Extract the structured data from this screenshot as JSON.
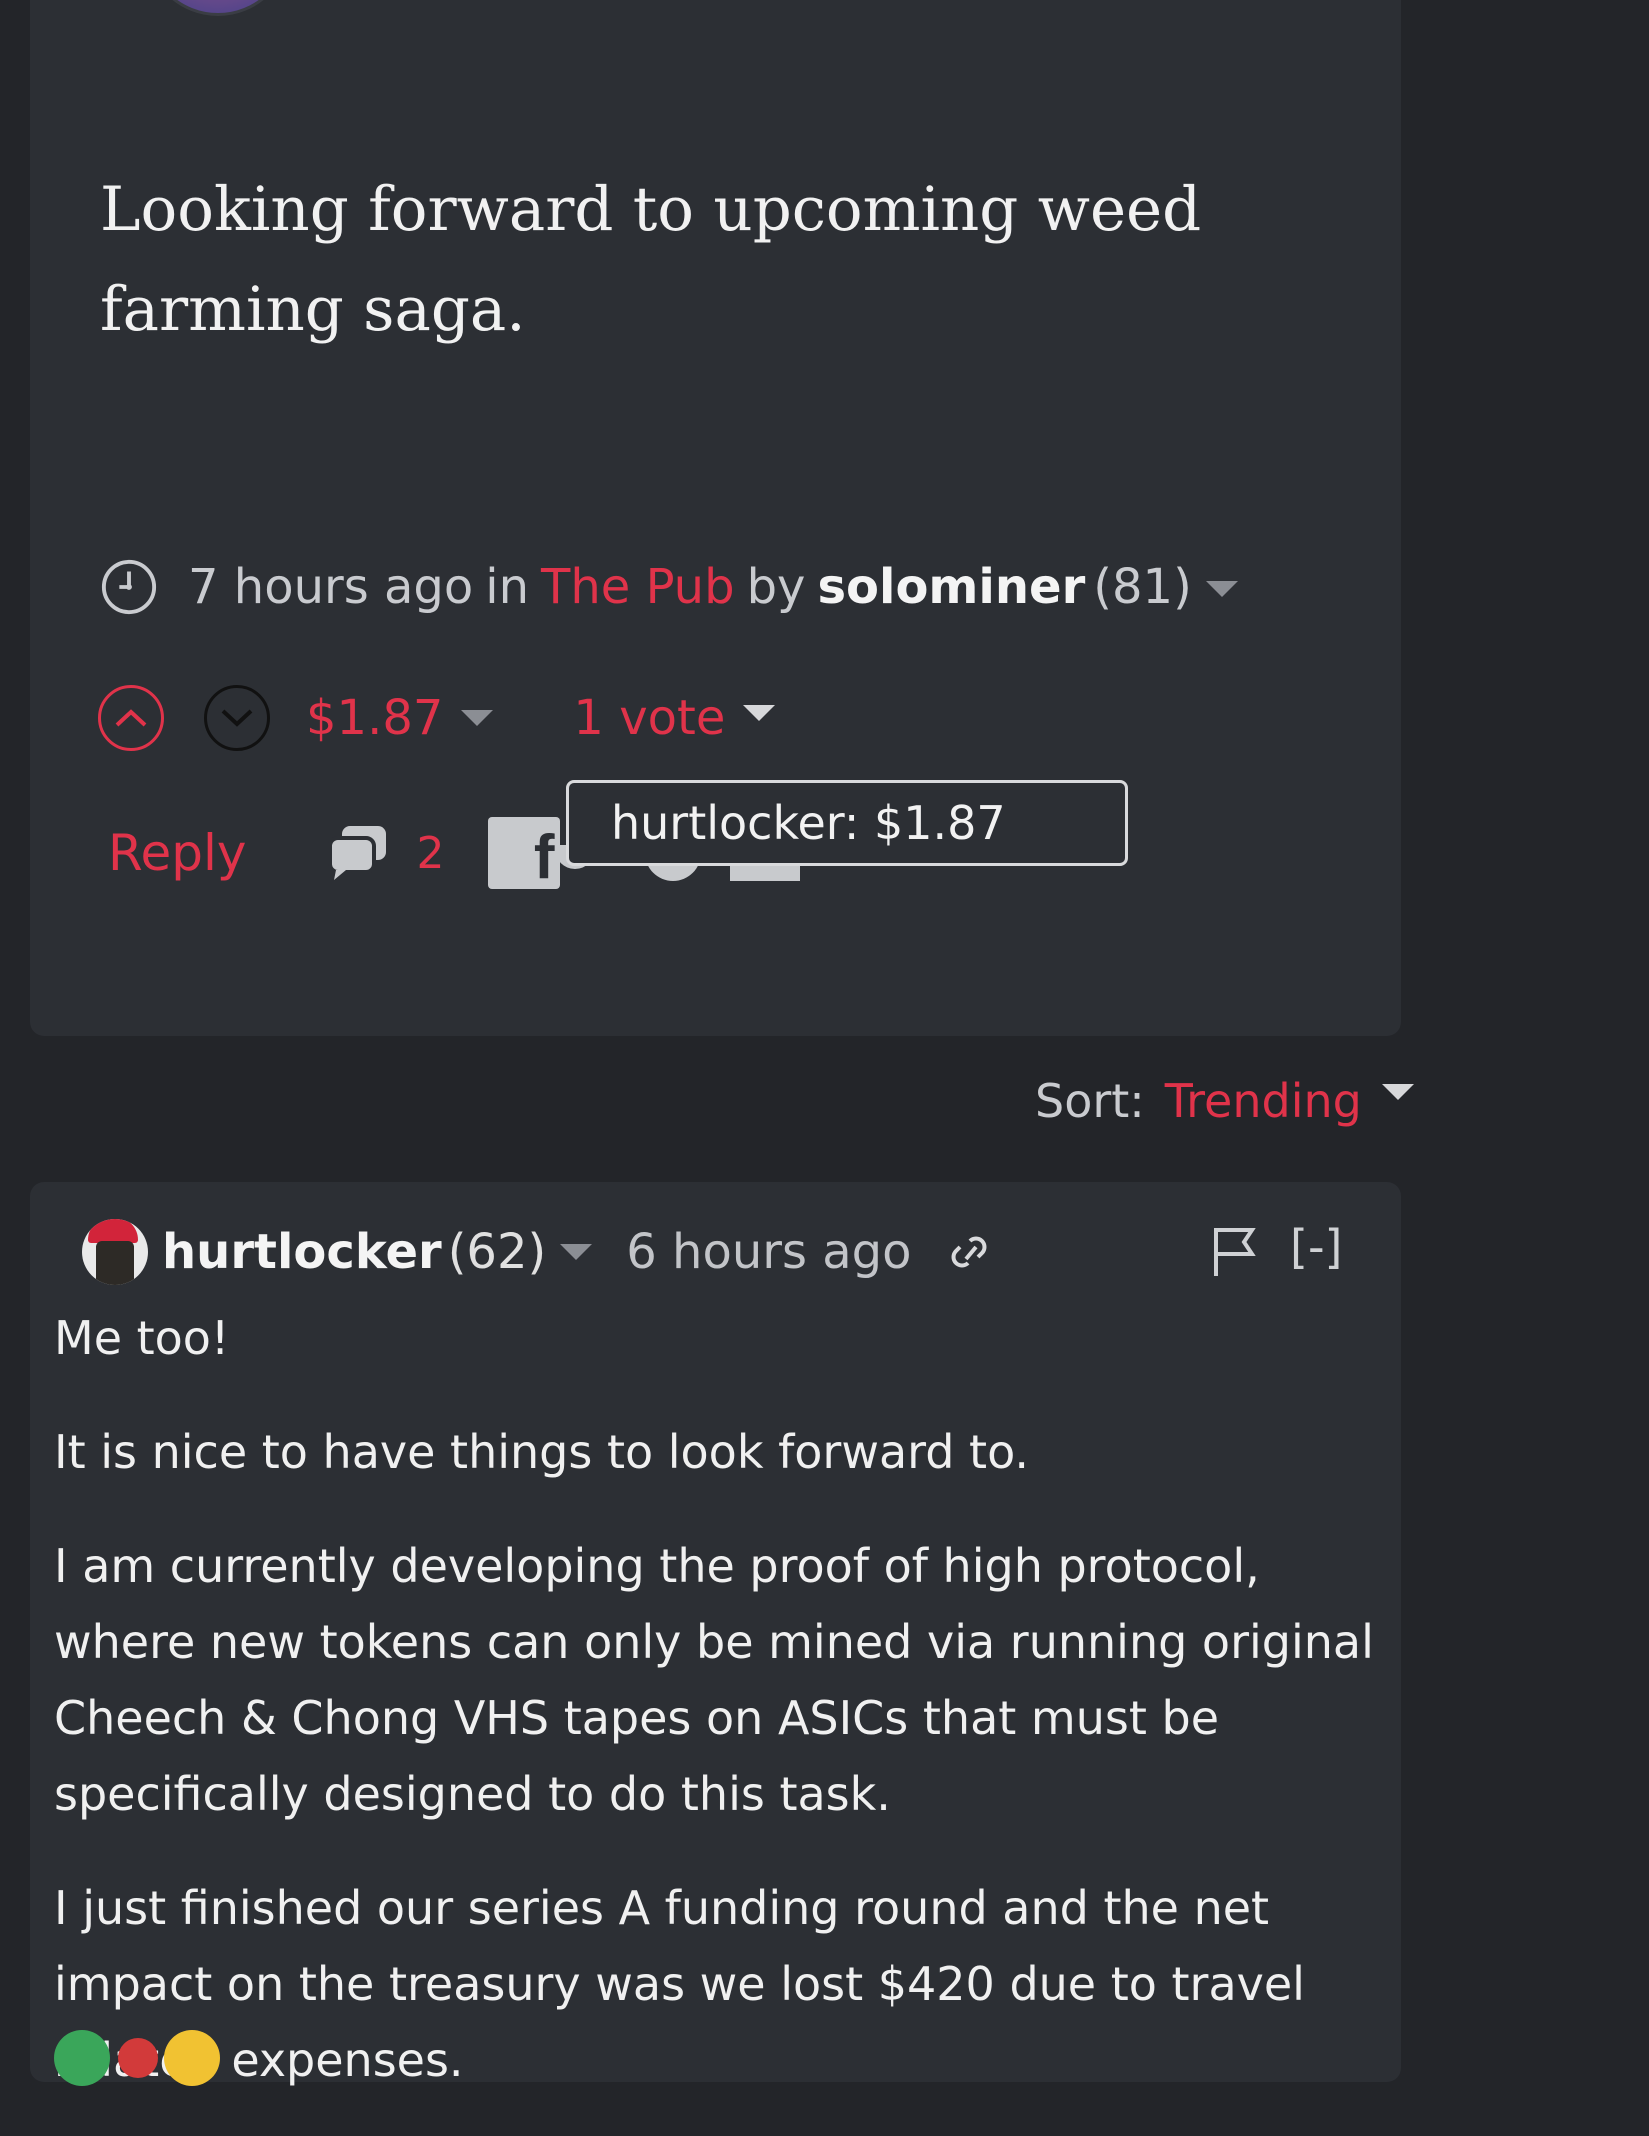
{
  "post": {
    "body": "Looking forward to upcoming weed farming saga.",
    "time": "7 hours ago",
    "in_label": "in",
    "community": "The Pub",
    "by_label": "by",
    "author": "solominer",
    "reputation": "(81)",
    "payout": "$1.87",
    "votes": "1 vote",
    "reply_label": "Reply",
    "comment_count": "2",
    "tooltip": "hurtlocker: $1.87"
  },
  "sort": {
    "label": "Sort:",
    "value": "Trending"
  },
  "comment": {
    "user": "hurtlocker",
    "reputation": "(62)",
    "time": "6 hours ago",
    "collapse_label": "[-]",
    "paragraphs": [
      "Me too!",
      "It is nice to have things to look forward to.",
      "I am currently developing the proof of high protocol, where new tokens can only be mined via running original Cheech & Chong VHS tapes on ASICs that must be specifically designed to do this task.",
      "I just finished our series A funding round and the net impact on the treasury was we lost $420 due to travel related expenses."
    ]
  },
  "colors": {
    "background": "#232529",
    "card": "#2c2f34",
    "accent": "#e0334a"
  },
  "icons": [
    "clock-icon",
    "upvote-icon",
    "downvote-icon",
    "comment-bubble-icon",
    "facebook-icon",
    "link-icon",
    "flag-icon"
  ]
}
